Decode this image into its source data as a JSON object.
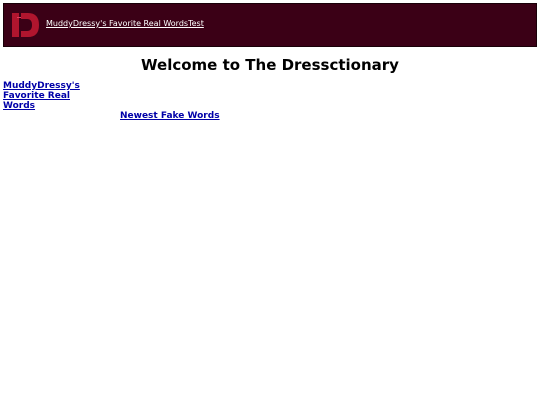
{
  "header": {
    "nav_links": [
      {
        "label": "MuddyDressy's Favorite Real Words"
      },
      {
        "label": "Test"
      }
    ]
  },
  "main": {
    "title": "Welcome to The Dressctionary",
    "links": [
      {
        "label": "MuddyDressy's Favorite Real Words"
      },
      {
        "label": "Newest Fake Words"
      }
    ]
  },
  "colors": {
    "header_bg": "#3b0016",
    "logo_red": "#b0152e",
    "link_blue": "#0000a8"
  },
  "icons": {
    "logo": "dressctionary-logo"
  }
}
